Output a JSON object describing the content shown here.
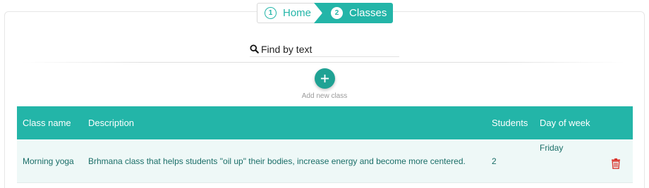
{
  "breadcrumb": {
    "steps": [
      {
        "number": "1",
        "label": "Home"
      },
      {
        "number": "2",
        "label": "Classes"
      }
    ]
  },
  "search": {
    "placeholder": "Find by text",
    "value": ""
  },
  "add": {
    "label": "Add new class",
    "icon": "plus-icon"
  },
  "table": {
    "columns": [
      "Class name",
      "Description",
      "Students",
      "Day of week"
    ],
    "rows": [
      {
        "class_name": "Morning yoga",
        "description": "Brhmana class that helps students \"oil up\" their bodies, increase energy and become more centered.",
        "students": "2",
        "day_of_week": "Friday"
      }
    ]
  },
  "colors": {
    "accent": "#23b5a8",
    "row_bg": "#eef8f7",
    "delete": "#d9342b"
  }
}
